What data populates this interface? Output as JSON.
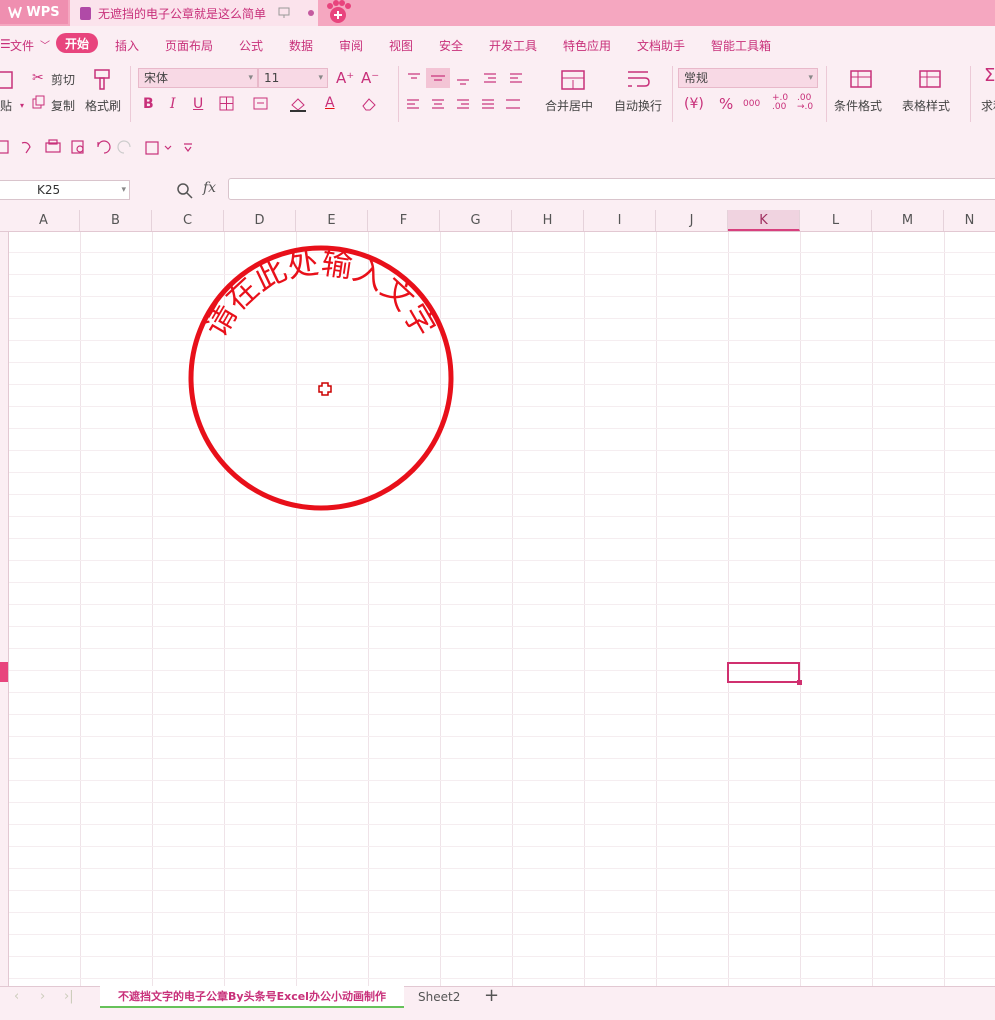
{
  "app": {
    "logo": "WPS",
    "document_tab": "无遮挡的电子公章就是这么简单"
  },
  "menu": {
    "file": "文件",
    "items": [
      "开始",
      "插入",
      "页面布局",
      "公式",
      "数据",
      "审阅",
      "视图",
      "安全",
      "开发工具",
      "特色应用",
      "文档助手",
      "智能工具箱"
    ]
  },
  "ribbon": {
    "paste": "贴",
    "cut": "剪切",
    "copy": "复制",
    "format_painter": "格式刷",
    "font_name": "宋体",
    "font_size": "11",
    "bold": "B",
    "italic": "I",
    "underline": "U",
    "font_color_letter": "A",
    "merge_center": "合并居中",
    "wrap_text": "自动换行",
    "number_format": "常规",
    "currency": "¥",
    "percent": "%",
    "thousands": "000",
    "increase_decimal": "+.0\n.00",
    "decrease_decimal": ".00\n→.0",
    "conditional_format": "条件格式",
    "table_style": "表格样式",
    "sum": "求和"
  },
  "formula_bar": {
    "cell_ref": "K25",
    "fx": "fx",
    "value": ""
  },
  "columns": [
    "A",
    "B",
    "C",
    "D",
    "E",
    "F",
    "G",
    "H",
    "I",
    "J",
    "K",
    "L",
    "M",
    "N"
  ],
  "active_column": "K",
  "seal": {
    "text": "请在此处输入文字",
    "color": "#e8101a"
  },
  "sheets": {
    "tabs": [
      "不遮挡文字的电子公章By头条号Excel办公小动画制作",
      "Sheet2"
    ],
    "add": "+"
  }
}
